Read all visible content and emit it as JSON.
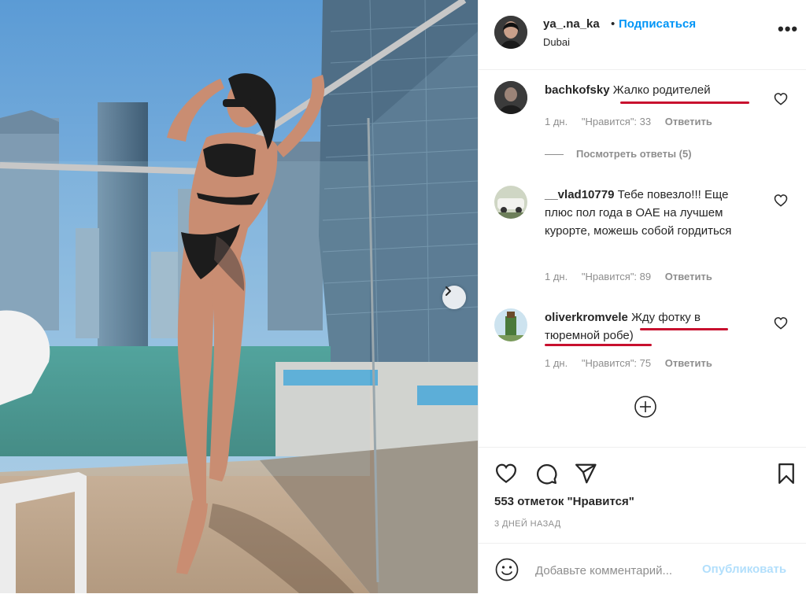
{
  "post": {
    "username": "ya_.na_ka",
    "separator": "•",
    "follow_label": "Подписаться",
    "location": "Dubai",
    "more_icon": "more-dots-icon",
    "likes_text": "553 отметок \"Нравится\"",
    "time_ago": "3 ДНЕЙ НАЗАД"
  },
  "comments": [
    {
      "username": "bachkofsky",
      "text": "Жалко родителей",
      "time": "1 дн.",
      "likes": "\"Нравится\": 33",
      "reply": "Ответить",
      "view_replies": "Посмотреть ответы (5)"
    },
    {
      "username": "__vlad10779",
      "text": "Тебе повезло!!! Еще плюс пол года в ОАЕ на лучшем курорте, можешь собой гордиться",
      "time": "1 дн.",
      "likes": "\"Нравится\": 89",
      "reply": "Ответить"
    },
    {
      "username": "oliverkromvele",
      "text": "Жду фотку в тюремной робе)",
      "time": "1 дн.",
      "likes": "\"Нравится\": 75",
      "reply": "Ответить"
    }
  ],
  "add_comment": {
    "placeholder": "Добавьте комментарий...",
    "publish_label": "Опубликовать"
  },
  "colors": {
    "link_blue": "#0095f6",
    "publish_disabled": "#b2dffc",
    "annotation_red": "#c8102e",
    "muted_text": "#8e8e8e"
  },
  "icons": [
    "heart-icon",
    "comment-icon",
    "share-icon",
    "bookmark-icon",
    "emoji-icon",
    "plus-circle-icon",
    "chevron-right-icon"
  ]
}
